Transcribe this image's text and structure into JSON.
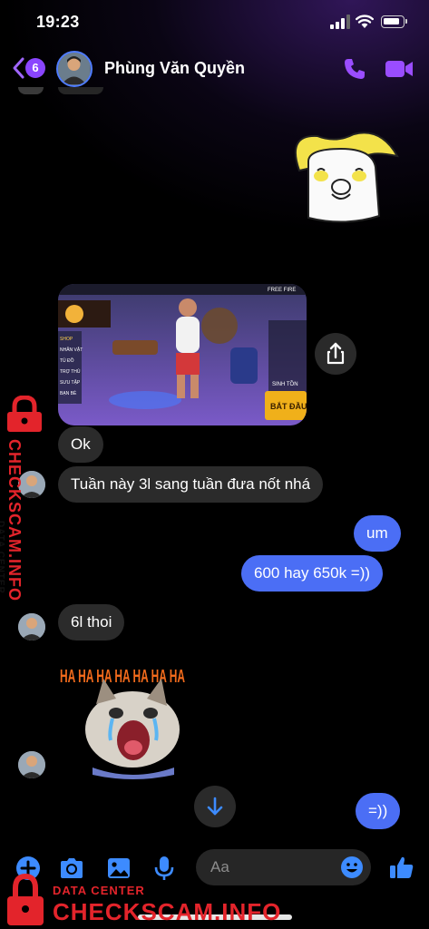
{
  "status_bar": {
    "time": "19:23"
  },
  "header": {
    "back_badge": "6",
    "contact_name": "Phùng Văn Quyền",
    "icons": [
      "back-chevron-icon",
      "phone-icon",
      "video-camera-icon"
    ]
  },
  "messages": {
    "photo_game": {
      "corner_title": "FREE FIRE",
      "menu": [
        "SHOP",
        "NHÂN VẬT",
        "TỦ ĐỒ",
        "TRỢ THỦ",
        "SƯU TẬP",
        "BẠN BÈ"
      ],
      "play_button": "BẮT ĐẦU",
      "side_label": "SINH TỒN"
    },
    "ok": "Ok",
    "week_note": "Tuần này 3l sang tuần đưa nốt nhá",
    "um": "um",
    "question": "600 hay 650k =))",
    "reply": "6l thoi",
    "sticker_text": "HA HA HA HA HA HA HA",
    "last_sent": "=))"
  },
  "composer": {
    "placeholder": "Aa",
    "icons": [
      "plus-circle-icon",
      "camera-icon",
      "image-icon",
      "microphone-icon",
      "emoji-icon",
      "thumbs-up-icon"
    ]
  },
  "watermark": {
    "small": "DATA CENTER",
    "big": "CHECKSCAM.INFO"
  },
  "colors": {
    "accent_purple": "#8a45ff",
    "outgoing_bubble": "#4b6ef5",
    "incoming_bubble": "#2b2b2b",
    "icon_blue": "#3d8bff",
    "watermark_red": "#e3242b"
  }
}
